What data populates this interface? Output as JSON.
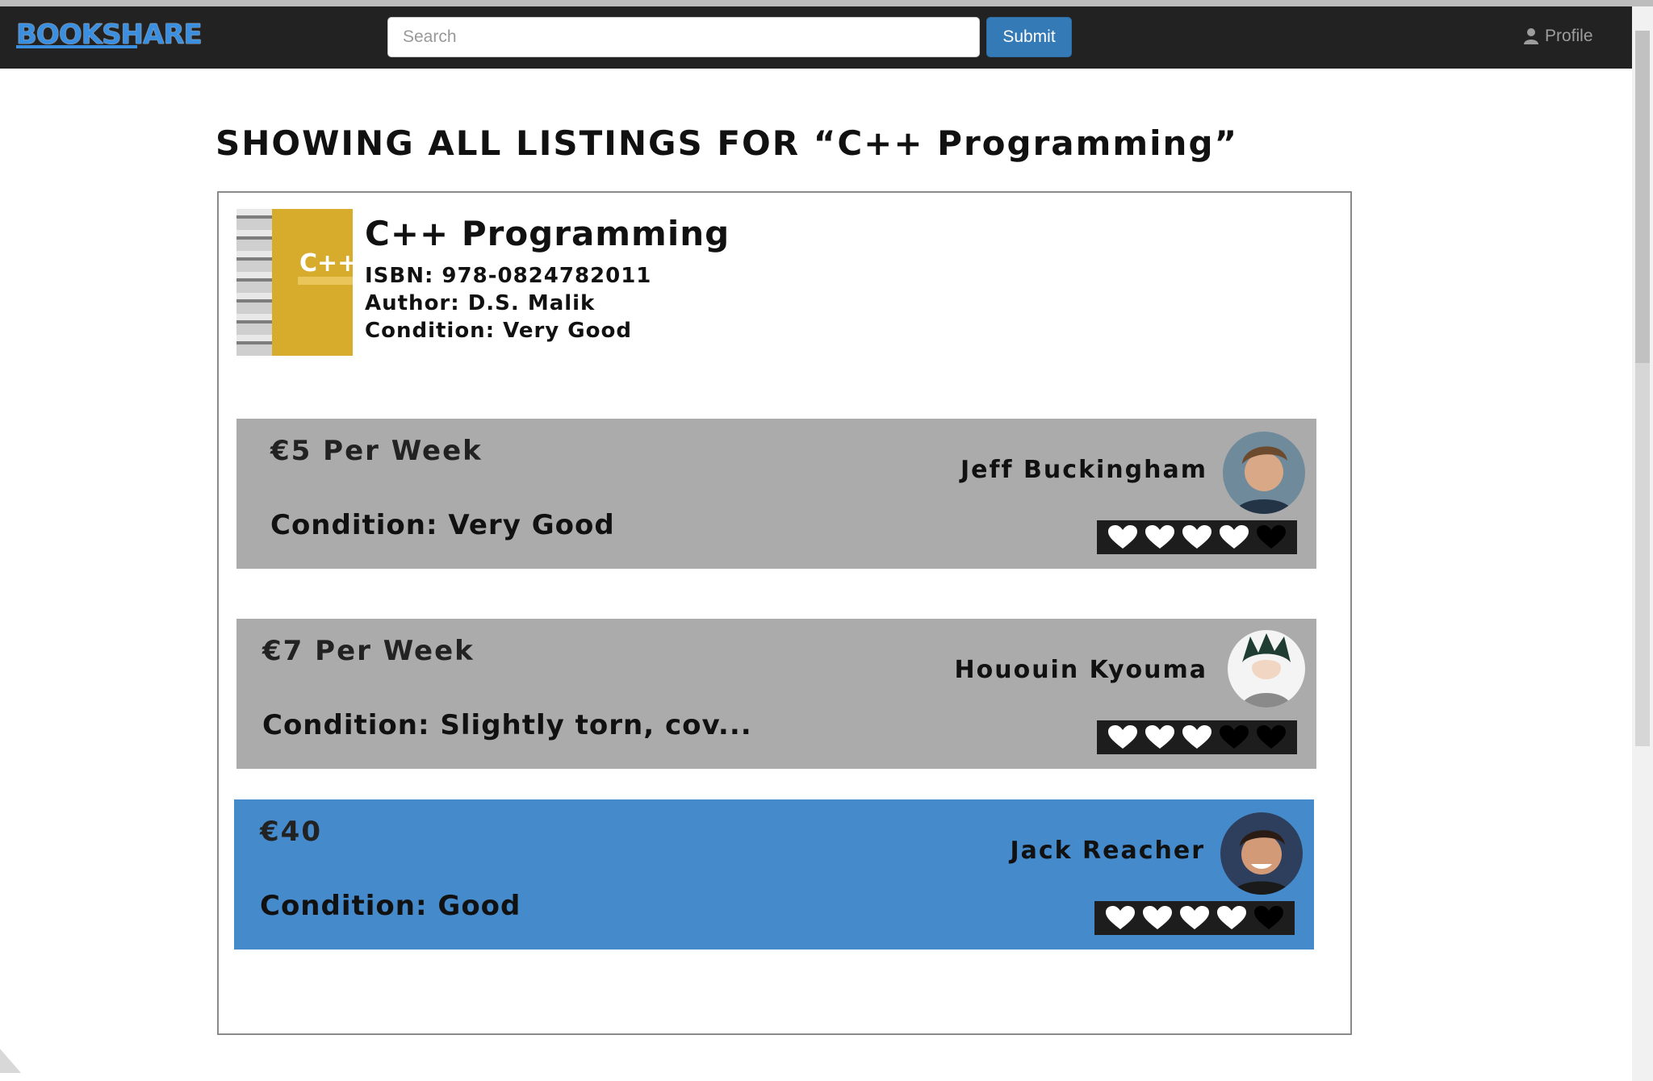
{
  "navbar": {
    "logo": "BOOKSHARE",
    "search_placeholder": "Search",
    "submit_label": "Submit",
    "profile_label": "Profile",
    "background": "#222222",
    "accent": "#337ab7"
  },
  "page": {
    "heading": "SHOWING ALL LISTINGS FOR “C++ Programming”"
  },
  "book": {
    "title": "C++ Programming",
    "isbn": "ISBN: 978-0824782011",
    "author": "Author: D.S. Malik",
    "condition": "Condition: Very Good",
    "cover_text": "C++"
  },
  "listings": [
    {
      "price": "€5 Per Week",
      "condition": "Condition: Very Good",
      "seller": "Jeff Buckingham",
      "rating": 4,
      "rating_max": 5,
      "selected": false
    },
    {
      "price": "€7 Per Week",
      "condition": "Condition: Slightly torn, cov...",
      "seller": "Hououin Kyouma",
      "rating": 3,
      "rating_max": 5,
      "selected": false
    },
    {
      "price": "€40",
      "condition": "Condition: Good",
      "seller": "Jack Reacher",
      "rating": 4,
      "rating_max": 5,
      "selected": true
    }
  ],
  "icons": {
    "profile": "user-icon",
    "rating": "heart-icon"
  },
  "colors": {
    "listing_default": "#ababab",
    "listing_selected": "#458bcc",
    "heart_filled": "#ffffff",
    "heart_empty": "#000000"
  }
}
